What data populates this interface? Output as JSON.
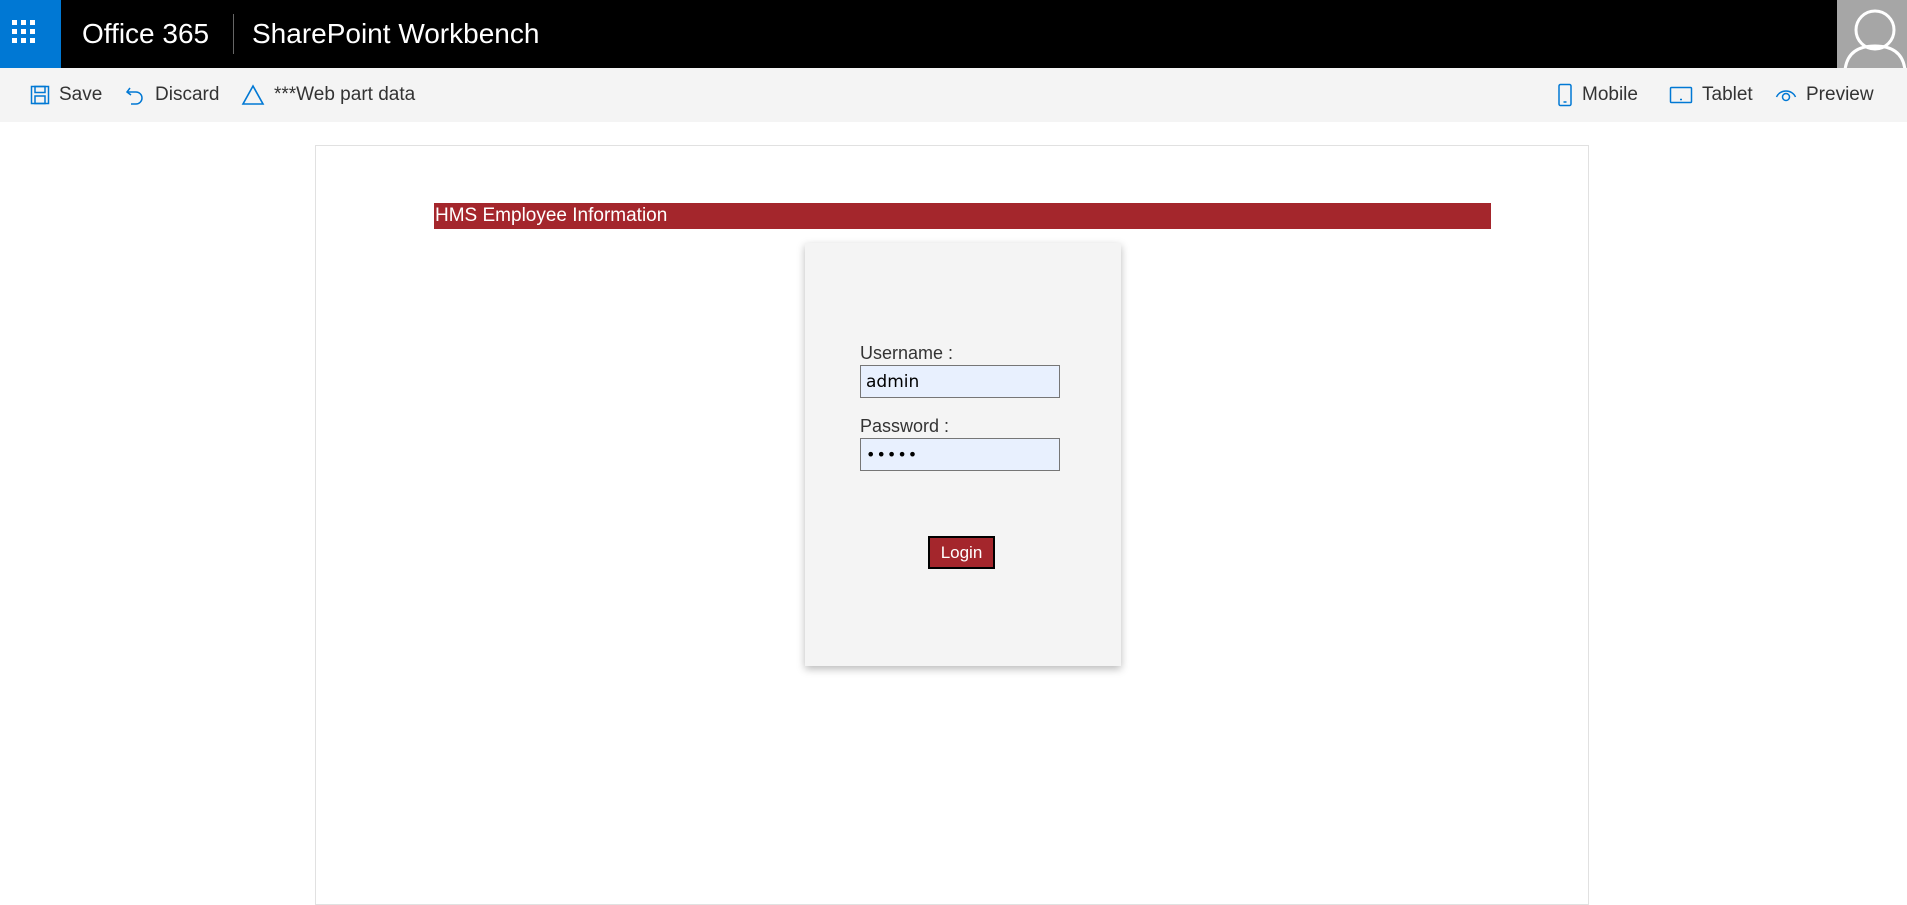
{
  "suite_bar": {
    "brand": "Office 365",
    "app_title": "SharePoint Workbench",
    "colors": {
      "background": "#000000",
      "waffle": "#0078d4",
      "avatar_bg": "#a6a6a6"
    },
    "icons": {
      "waffle": "app-launcher-icon",
      "avatar": "user-avatar-icon"
    }
  },
  "command_bar": {
    "left": [
      {
        "label": "Save",
        "icon": "save-icon"
      },
      {
        "label": "Discard",
        "icon": "undo-icon"
      },
      {
        "label": "***Web part data",
        "icon": "triangle-icon"
      }
    ],
    "right": [
      {
        "label": "Mobile",
        "icon": "mobile-icon"
      },
      {
        "label": "Tablet",
        "icon": "tablet-icon"
      },
      {
        "label": "Preview",
        "icon": "eye-icon"
      }
    ],
    "colors": {
      "background": "#f4f4f4",
      "icon": "#0078d4"
    }
  },
  "webpart": {
    "banner_title": "HMS Employee Information",
    "accent": "#a4262c",
    "login": {
      "username_label": "Username :",
      "username_value": "admin",
      "password_label": "Password :",
      "password_value": "•••••",
      "login_button": "Login"
    }
  }
}
